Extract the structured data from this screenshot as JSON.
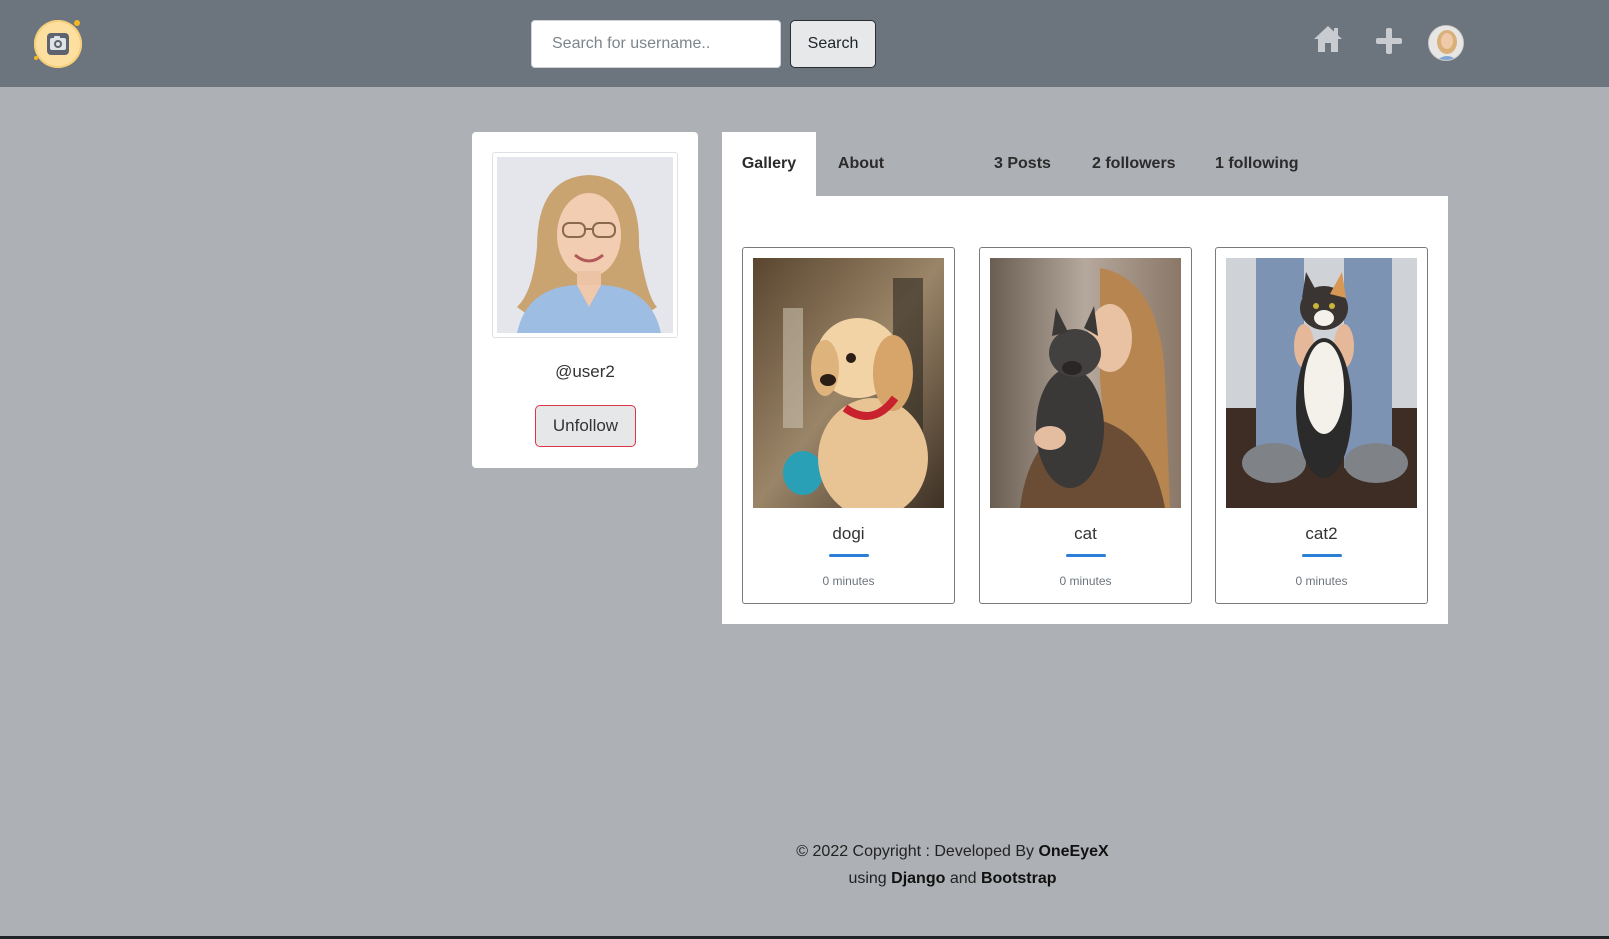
{
  "navbar": {
    "logo_icon": "camera-logo-icon",
    "search": {
      "placeholder": "Search for username..",
      "button_label": "Search"
    },
    "icons": [
      "home-icon",
      "plus-icon",
      "avatar"
    ]
  },
  "profile": {
    "username": "@user2",
    "unfollow_label": "Unfollow"
  },
  "tabs": {
    "gallery": "Gallery",
    "about": "About",
    "posts": "3 Posts",
    "followers": "2 followers",
    "following": "1 following"
  },
  "posts": [
    {
      "title": "dogi",
      "time": "0 minutes"
    },
    {
      "title": "cat",
      "time": "0 minutes"
    },
    {
      "title": "cat2",
      "time": "0 minutes"
    }
  ],
  "footer": {
    "line1_prefix": "© 2022 Copyright : Developed By ",
    "developer": "OneEyeX",
    "line2_prefix": "using ",
    "tech1": "Django",
    "line2_mid": " and ",
    "tech2": "Bootstrap"
  },
  "colors": {
    "navbar": "#6c757d",
    "page_bg": "#adb0b5",
    "accent": "#2c7fd6",
    "unfollow_border": "#dc3545"
  }
}
